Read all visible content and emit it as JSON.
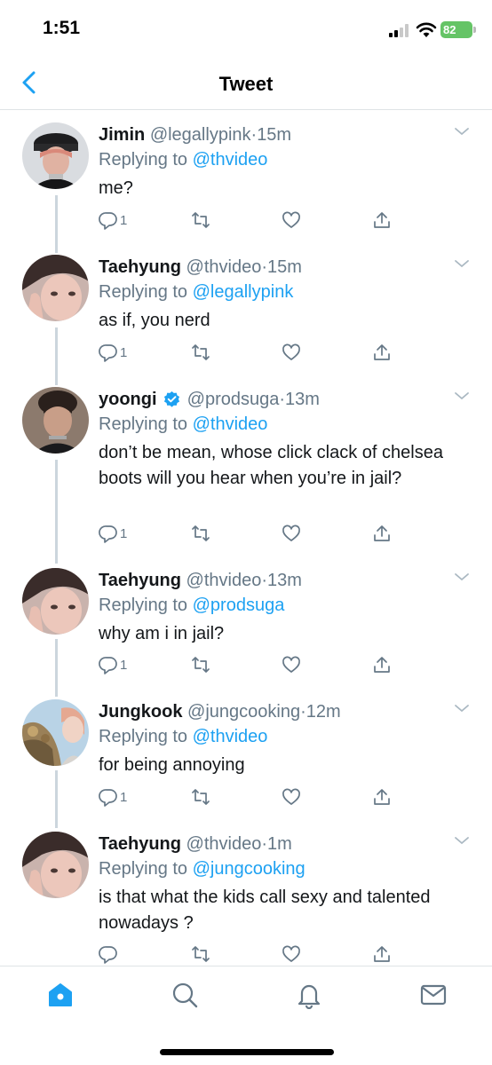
{
  "status_bar": {
    "time": "1:51",
    "battery": "82"
  },
  "header": {
    "title": "Tweet"
  },
  "colors": {
    "accent": "#1da1f2",
    "secondary_text": "#657786",
    "thread_line": "#ccd6dd"
  },
  "tweets": [
    {
      "name": "Jimin",
      "handle": "@legallypink",
      "dot": "·",
      "time": "15m",
      "verified": false,
      "replying_prefix": "Replying to",
      "replying_to": "@thvideo",
      "text": "me?",
      "reply_count": "1"
    },
    {
      "name": "Taehyung",
      "handle": "@thvideo",
      "dot": "·",
      "time": "15m",
      "verified": false,
      "replying_prefix": "Replying to",
      "replying_to": "@legallypink",
      "text": "as if, you nerd",
      "reply_count": "1"
    },
    {
      "name": "yoongi",
      "handle": "@prodsuga",
      "dot": "·",
      "time": "13m",
      "verified": true,
      "replying_prefix": "Replying to",
      "replying_to": "@thvideo",
      "text": "don’t be mean, whose click clack of chelsea boots will you hear when you’re in jail?",
      "reply_count": "1"
    },
    {
      "name": "Taehyung",
      "handle": "@thvideo",
      "dot": "·",
      "time": "13m",
      "verified": false,
      "replying_prefix": "Replying to",
      "replying_to": "@prodsuga",
      "text": "why am i in jail?",
      "reply_count": "1"
    },
    {
      "name": "Jungkook",
      "handle": "@jungcooking",
      "dot": "·",
      "time": "12m",
      "verified": false,
      "replying_prefix": "Replying to",
      "replying_to": "@thvideo",
      "text": "for being annoying",
      "reply_count": "1"
    },
    {
      "name": "Taehyung",
      "handle": "@thvideo",
      "dot": "·",
      "time": "1m",
      "verified": false,
      "replying_prefix": "Replying to",
      "replying_to": "@jungcooking",
      "text": "is that what the kids call sexy and talented nowadays ?",
      "reply_count": ""
    }
  ],
  "icons": {
    "back": "chevron-left-icon",
    "caret": "chevron-down-icon",
    "actions": [
      "reply-icon",
      "retweet-icon",
      "like-icon",
      "share-icon"
    ],
    "tabs": [
      "home-icon",
      "search-icon",
      "notifications-icon",
      "messages-icon"
    ]
  }
}
